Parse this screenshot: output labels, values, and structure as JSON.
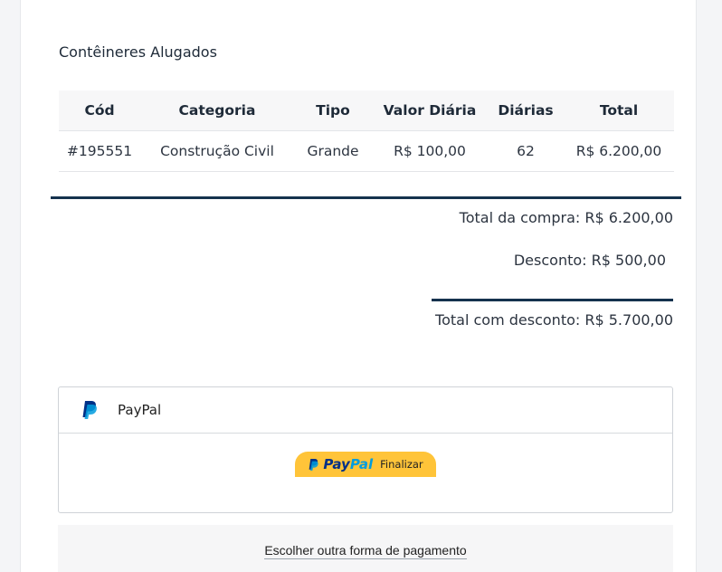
{
  "section": {
    "title": "Contêineres Alugados"
  },
  "table": {
    "headers": [
      "Cód",
      "Categoria",
      "Tipo",
      "Valor Diária",
      "Diárias",
      "Total"
    ],
    "rows": [
      [
        "#195551",
        "Construção Civil",
        "Grande",
        "R$ 100,00",
        "62",
        "R$ 6.200,00"
      ]
    ]
  },
  "summary": {
    "total_compra": "Total da compra: R$ 6.200,00",
    "desconto": "Desconto:  R$ 500,00",
    "total_desconto": "Total com desconto: R$ 5.700,00"
  },
  "payment": {
    "method_label": "PayPal",
    "button_brand_pay": "Pay",
    "button_brand_pal": "Pal",
    "button_action": "Finalizar",
    "alternative_link": "Escolher outra forma de pagamento"
  },
  "colors": {
    "divider": "#15324e",
    "paypal_button": "#ffc439",
    "paypal_dark": "#003087",
    "paypal_light": "#009cde"
  }
}
